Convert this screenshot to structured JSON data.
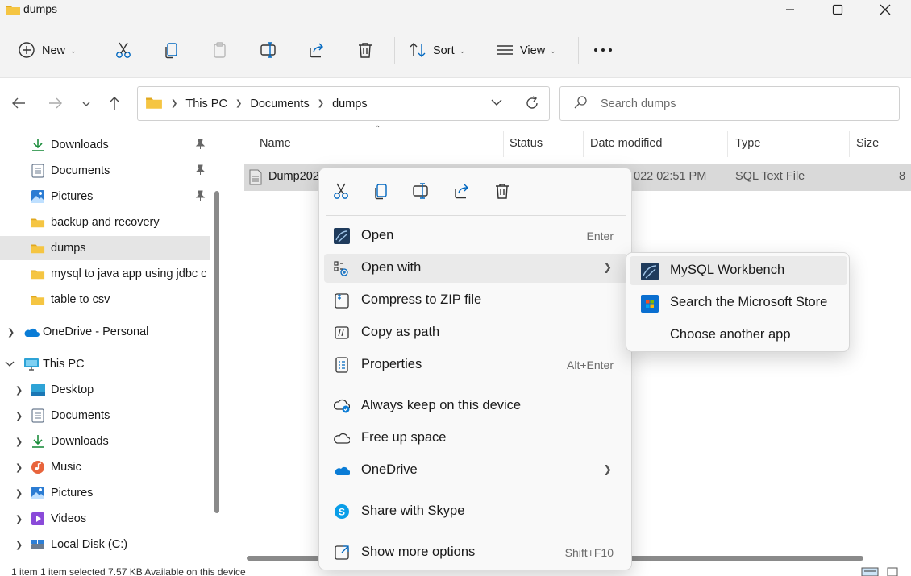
{
  "window": {
    "title": "dumps"
  },
  "toolbar": {
    "new_label": "New",
    "sort_label": "Sort",
    "view_label": "View"
  },
  "address": {
    "crumbs": [
      "This PC",
      "Documents",
      "dumps"
    ]
  },
  "search": {
    "placeholder": "Search dumps"
  },
  "sidebar": {
    "items": [
      {
        "label": "Downloads",
        "icon": "download-icon",
        "pinned": true
      },
      {
        "label": "Documents",
        "icon": "document-icon",
        "pinned": true
      },
      {
        "label": "Pictures",
        "icon": "pictures-icon",
        "pinned": true
      },
      {
        "label": "backup and recovery",
        "icon": "folder-icon"
      },
      {
        "label": "dumps",
        "icon": "folder-icon",
        "selected": true
      },
      {
        "label": "mysql to java app using jdbc c",
        "icon": "folder-icon"
      },
      {
        "label": "table to csv",
        "icon": "folder-icon"
      },
      {
        "label": "OneDrive - Personal",
        "icon": "onedrive-icon"
      },
      {
        "label": "This PC",
        "icon": "pc-icon"
      },
      {
        "label": "Desktop",
        "icon": "desktop-icon"
      },
      {
        "label": "Documents",
        "icon": "document-icon"
      },
      {
        "label": "Downloads",
        "icon": "download-icon"
      },
      {
        "label": "Music",
        "icon": "music-icon"
      },
      {
        "label": "Pictures",
        "icon": "pictures-icon"
      },
      {
        "label": "Videos",
        "icon": "videos-icon"
      },
      {
        "label": "Local Disk (C:)",
        "icon": "disk-icon"
      }
    ]
  },
  "filelist": {
    "columns": [
      "Name",
      "Status",
      "Date modified",
      "Type",
      "Size"
    ],
    "rows": [
      {
        "name": "Dump202",
        "date": "022 02:51 PM",
        "type": "SQL Text File",
        "size": "8"
      }
    ]
  },
  "context_menu": {
    "items": [
      {
        "label": "Open",
        "shortcut": "Enter"
      },
      {
        "label": "Open with"
      },
      {
        "label": "Compress to ZIP file"
      },
      {
        "label": "Copy as path"
      },
      {
        "label": "Properties",
        "shortcut": "Alt+Enter"
      },
      {
        "label": "Always keep on this device"
      },
      {
        "label": "Free up space"
      },
      {
        "label": "OneDrive"
      },
      {
        "label": "Share with Skype"
      },
      {
        "label": "Show more options",
        "shortcut": "Shift+F10"
      }
    ]
  },
  "submenu": {
    "items": [
      {
        "label": "MySQL Workbench"
      },
      {
        "label": "Search the Microsoft Store"
      },
      {
        "label": "Choose another app"
      }
    ]
  },
  "statusbar": {
    "text": "1 item    1 item selected  7.57 KB    Available on this device"
  },
  "colors": {
    "accent": "#0067c0",
    "folder": "#f5c542",
    "onedrive": "#0a7cd6",
    "skype": "#0a9ee8"
  }
}
